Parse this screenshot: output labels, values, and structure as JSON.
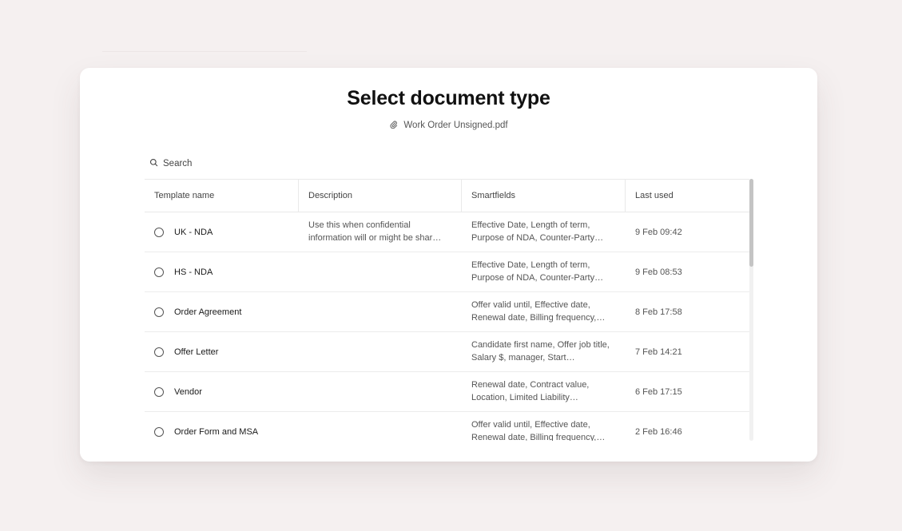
{
  "dialog": {
    "title": "Select document type",
    "file": {
      "icon": "paperclip-icon",
      "name": "Work Order Unsigned.pdf"
    }
  },
  "search": {
    "icon": "search-icon",
    "placeholder": "Search"
  },
  "table": {
    "headers": [
      "Template name",
      "Description",
      "Smartfields",
      "Last used"
    ],
    "rows": [
      {
        "name": "UK - NDA",
        "description": "Use this when confidential information will or might be shar…",
        "smartfields": "Effective Date, Length of term, Purpose of NDA, Counter-Party…",
        "last_used": "9 Feb 09:42"
      },
      {
        "name": "HS - NDA",
        "description": "",
        "smartfields": "Effective Date, Length of term, Purpose of NDA, Counter-Party…",
        "last_used": "9 Feb 08:53"
      },
      {
        "name": "Order Agreement",
        "description": "",
        "smartfields": "Offer valid until, Effective date, Renewal date, Billing frequency,…",
        "last_used": "8 Feb 17:58"
      },
      {
        "name": "Offer Letter",
        "description": "",
        "smartfields": "Candidate first name, Offer job title, Salary $, manager, Start…",
        "last_used": "7 Feb 14:21"
      },
      {
        "name": "Vendor",
        "description": "",
        "smartfields": "Renewal date, Contract value, Location, Limited Liability…",
        "last_used": "6 Feb 17:15"
      },
      {
        "name": "Order Form and MSA",
        "description": "",
        "smartfields": "Offer valid until, Effective date, Renewal date, Billing frequency,…",
        "last_used": "2 Feb 16:46"
      }
    ]
  },
  "colors": {
    "background": "#f5f0f0",
    "surface": "#ffffff",
    "border": "#e9e9e9",
    "text": "#1a1a1a",
    "muted": "#555555"
  }
}
